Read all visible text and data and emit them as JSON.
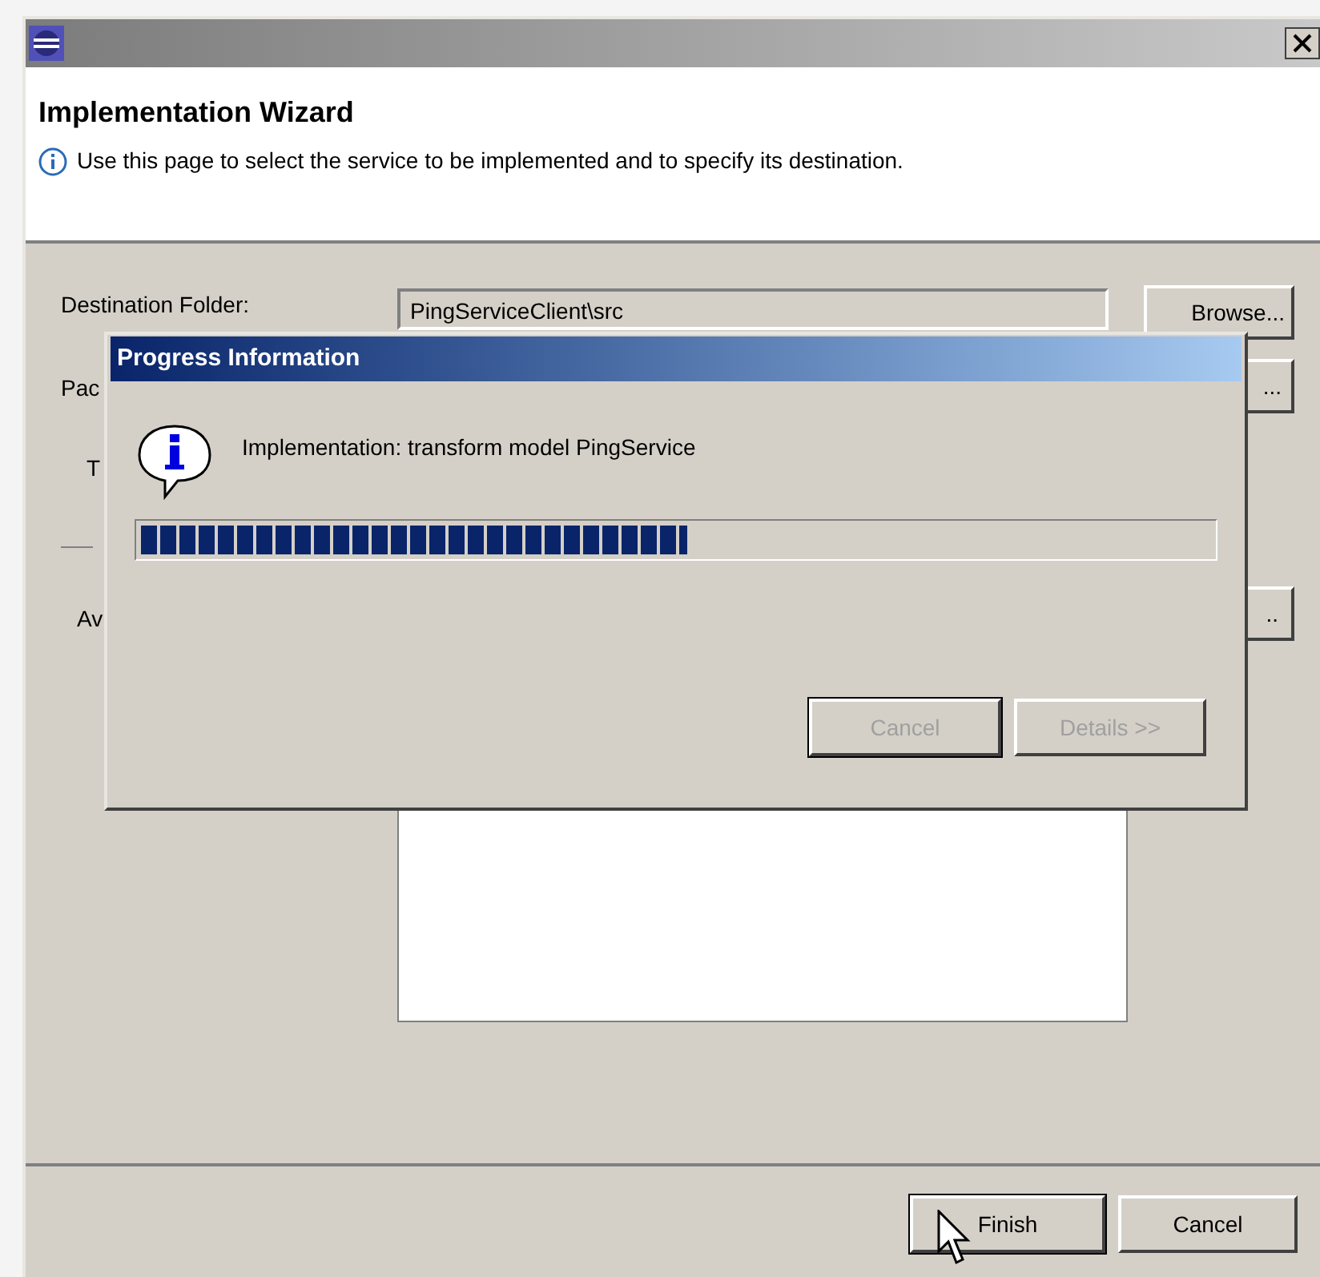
{
  "wizard": {
    "title": "Implementation Wizard",
    "description": "Use this page to select the service to be implemented and to specify its destination.",
    "destination_label": "Destination Folder:",
    "destination_value": "PingServiceClient\\src",
    "browse_button": "Browse...",
    "label_2": "Pac",
    "button_2": "...",
    "label_3": "T",
    "label_4": "Av",
    "button_3": "..",
    "buttons": [
      {
        "label": "Finish",
        "default": true
      },
      {
        "label": "Cancel",
        "default": false
      }
    ]
  },
  "progress_dialog": {
    "title": "Progress Information",
    "message": "Implementation: transform model PingService",
    "level": 0.51,
    "buttons": [
      {
        "label": "Cancel",
        "disabled": true,
        "default": true
      },
      {
        "label": "Details >>",
        "disabled": true,
        "default": false
      }
    ]
  }
}
